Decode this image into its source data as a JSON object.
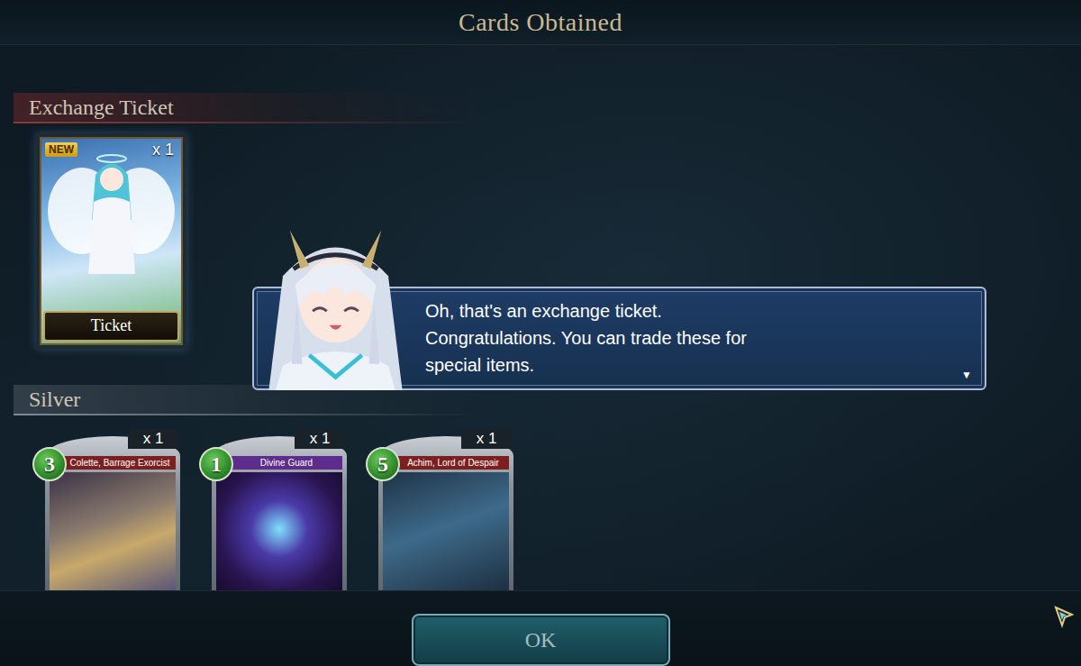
{
  "title": "Cards Obtained",
  "exchange_ticket": {
    "heading": "Exchange Ticket",
    "new": true,
    "badge": "NEW",
    "count": "x 1",
    "label": "Ticket"
  },
  "dialog": {
    "lines": [
      "Oh, that's an exchange ticket.",
      "Congratulations. You can trade these for",
      "special items."
    ],
    "more": "▼"
  },
  "silver": {
    "heading": "Silver",
    "cards": [
      {
        "cost": "3",
        "name": "Colette, Barrage Exorcist",
        "count": "x 1",
        "color": "#7e1f1f"
      },
      {
        "cost": "1",
        "name": "Divine Guard",
        "count": "x 1",
        "color": "#5e2c8c"
      },
      {
        "cost": "5",
        "name": "Achim, Lord of Despair",
        "count": "x 1",
        "color": "#7e1f1f"
      }
    ]
  },
  "buttons": [
    "OK"
  ]
}
